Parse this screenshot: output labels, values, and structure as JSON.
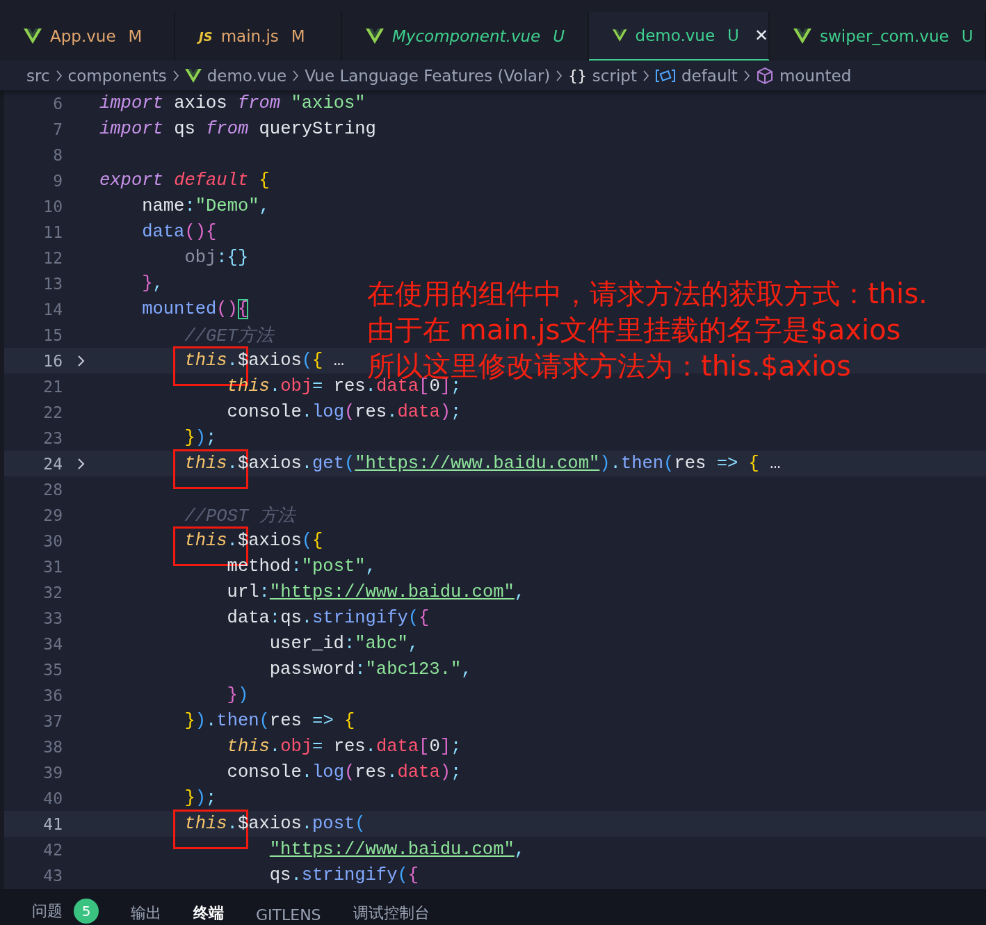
{
  "tabs": [
    {
      "kind": "vue",
      "label": "App.vue",
      "status": "M",
      "color": "#e2a56e",
      "preview": false,
      "selected": false,
      "closable": false
    },
    {
      "kind": "js",
      "label": "main.js",
      "status": "M",
      "color": "#e2a56e",
      "preview": false,
      "selected": false,
      "closable": false
    },
    {
      "kind": "vue",
      "label": "Mycomponent.vue",
      "status": "U",
      "color": "#3fcf8e",
      "preview": true,
      "selected": false,
      "closable": false
    },
    {
      "kind": "vue",
      "label": "demo.vue",
      "status": "U",
      "color": "#3fcf8e",
      "preview": false,
      "selected": true,
      "closable": true
    },
    {
      "kind": "vue",
      "label": "swiper_com.vue",
      "status": "U",
      "color": "#3fcf8e",
      "preview": false,
      "selected": false,
      "closable": false
    }
  ],
  "js_icon_text": "JS",
  "close_glyph": "✕",
  "breadcrumb": [
    {
      "text": "src",
      "kind": "folder"
    },
    {
      "text": "components",
      "kind": "folder"
    },
    {
      "text": "demo.vue",
      "kind": "vue"
    },
    {
      "text": "Vue Language Features (Volar)",
      "kind": "folder"
    },
    {
      "text": "script",
      "kind": "braces",
      "icon_text": "{}"
    },
    {
      "text": "default",
      "kind": "module"
    },
    {
      "text": "mounted",
      "kind": "method"
    }
  ],
  "editor": {
    "lines": [
      {
        "number": "6",
        "folded": false,
        "current": false,
        "tokens": [
          {
            "text": "import",
            "kind": "kw"
          },
          {
            "text": " axios ",
            "kind": "plain"
          },
          {
            "text": "from",
            "kind": "kw"
          },
          {
            "text": " \"axios\"",
            "kind": "str"
          }
        ]
      },
      {
        "number": "7",
        "folded": false,
        "current": false,
        "tokens": [
          {
            "text": "import",
            "kind": "kw"
          },
          {
            "text": " qs ",
            "kind": "plain"
          },
          {
            "text": "from",
            "kind": "kw"
          },
          {
            "text": " queryString",
            "kind": "plain"
          }
        ]
      },
      {
        "number": "8",
        "folded": false,
        "current": false
      },
      {
        "number": "9",
        "folded": false,
        "current": false,
        "tokens": [
          {
            "text": "export",
            "kind": "kw"
          },
          {
            "text": " default",
            "kind": "def"
          },
          {
            "text": " {",
            "kind": "brace"
          }
        ],
        "children": [
          {
            "number": "10",
            "folded": false,
            "current": false,
            "tokens": [
              {
                "text": "name",
                "kind": "plain"
              },
              {
                "text": ":",
                "kind": "punct"
              },
              {
                "text": "\"Demo\"",
                "kind": "str"
              },
              {
                "text": ",",
                "kind": "punct"
              }
            ]
          },
          {
            "number": "11",
            "folded": false,
            "current": false,
            "tokens": [
              {
                "text": "data",
                "kind": "fn"
              },
              {
                "text": "(){",
                "kind": "paren"
              }
            ],
            "children": [
              {
                "number": "12",
                "folded": false,
                "current": false,
                "tokens": [
                  {
                    "text": "obj",
                    "kind": "dim"
                  },
                  {
                    "text": ":{}",
                    "kind": "punct"
                  }
                ]
              }
            ]
          },
          {
            "number": "13",
            "folded": false,
            "current": false,
            "tokens": [
              {
                "text": "}",
                "kind": "paren"
              },
              {
                "text": ",",
                "kind": "punct"
              }
            ]
          },
          {
            "number": "14",
            "folded": false,
            "current": false,
            "tokens": [
              {
                "text": "mounted",
                "kind": "fn"
              },
              {
                "text": "()",
                "kind": "paren"
              },
              {
                "text": "{",
                "kind": "match"
              }
            ],
            "children": [
              {
                "number": "15",
                "folded": false,
                "current": false,
                "tokens": [
                  {
                    "text": "//GET方法",
                    "kind": "comment"
                  }
                ]
              },
              {
                "number": "16",
                "folded": true,
                "current": true,
                "tokens": [
                  {
                    "text": "this",
                    "kind": "this",
                    "boxed": true
                  },
                  {
                    "text": ".",
                    "kind": "punct"
                  },
                  {
                    "text": "$axios",
                    "kind": "plain"
                  },
                  {
                    "text": "(",
                    "kind": "paren2"
                  },
                  {
                    "text": "{",
                    "kind": "brace"
                  },
                  {
                    "text": " …",
                    "kind": "plain"
                  }
                ],
                "children": [
                  {
                    "number": "21",
                    "folded": false,
                    "current": false,
                    "tokens": [
                      {
                        "text": "this",
                        "kind": "this"
                      },
                      {
                        "text": ".",
                        "kind": "punct"
                      },
                      {
                        "text": "obj",
                        "kind": "red"
                      },
                      {
                        "text": "=",
                        "kind": "punct"
                      },
                      {
                        "text": " res",
                        "kind": "plain"
                      },
                      {
                        "text": ".",
                        "kind": "punct"
                      },
                      {
                        "text": "data",
                        "kind": "red"
                      },
                      {
                        "text": "[",
                        "kind": "paren"
                      },
                      {
                        "text": "0",
                        "kind": "plain"
                      },
                      {
                        "text": "]",
                        "kind": "paren"
                      },
                      {
                        "text": ";",
                        "kind": "punct"
                      }
                    ]
                  },
                  {
                    "number": "22",
                    "folded": false,
                    "current": false,
                    "tokens": [
                      {
                        "text": "console",
                        "kind": "plain"
                      },
                      {
                        "text": ".",
                        "kind": "punct"
                      },
                      {
                        "text": "log",
                        "kind": "fn"
                      },
                      {
                        "text": "(",
                        "kind": "paren"
                      },
                      {
                        "text": "res",
                        "kind": "plain"
                      },
                      {
                        "text": ".",
                        "kind": "punct"
                      },
                      {
                        "text": "data",
                        "kind": "red"
                      },
                      {
                        "text": ")",
                        "kind": "paren"
                      },
                      {
                        "text": ";",
                        "kind": "punct"
                      }
                    ]
                  }
                ]
              },
              {
                "number": "23",
                "folded": false,
                "current": false,
                "tokens": [
                  {
                    "text": "}",
                    "kind": "brace"
                  },
                  {
                    "text": ")",
                    "kind": "paren2"
                  },
                  {
                    "text": ";",
                    "kind": "punct"
                  }
                ]
              },
              {
                "number": "24",
                "folded": true,
                "current": true,
                "tokens": [
                  {
                    "text": "this",
                    "kind": "this",
                    "boxed": true
                  },
                  {
                    "text": ".",
                    "kind": "punct"
                  },
                  {
                    "text": "$axios",
                    "kind": "plain"
                  },
                  {
                    "text": ".",
                    "kind": "punct"
                  },
                  {
                    "text": "get",
                    "kind": "fn"
                  },
                  {
                    "text": "(",
                    "kind": "paren2"
                  },
                  {
                    "text": "\"https://www.baidu.com\"",
                    "kind": "link"
                  },
                  {
                    "text": ")",
                    "kind": "paren2"
                  },
                  {
                    "text": ".",
                    "kind": "punct"
                  },
                  {
                    "text": "then",
                    "kind": "fn"
                  },
                  {
                    "text": "(",
                    "kind": "paren2"
                  },
                  {
                    "text": "res ",
                    "kind": "plain"
                  },
                  {
                    "text": "=>",
                    "kind": "punct"
                  },
                  {
                    "text": " {",
                    "kind": "brace"
                  },
                  {
                    "text": " …",
                    "kind": "plain"
                  }
                ]
              },
              {
                "number": "28",
                "folded": false,
                "current": false
              },
              {
                "number": "29",
                "folded": false,
                "current": false,
                "tokens": [
                  {
                    "text": "//POST 方法",
                    "kind": "comment"
                  }
                ]
              },
              {
                "number": "30",
                "folded": false,
                "current": false,
                "tokens": [
                  {
                    "text": "this",
                    "kind": "this",
                    "boxed": true
                  },
                  {
                    "text": ".",
                    "kind": "punct"
                  },
                  {
                    "text": "$axios",
                    "kind": "plain"
                  },
                  {
                    "text": "(",
                    "kind": "paren2"
                  },
                  {
                    "text": "{",
                    "kind": "brace"
                  }
                ],
                "children": [
                  {
                    "number": "31",
                    "folded": false,
                    "current": false,
                    "tokens": [
                      {
                        "text": "method",
                        "kind": "plain"
                      },
                      {
                        "text": ":",
                        "kind": "punct"
                      },
                      {
                        "text": "\"post\"",
                        "kind": "str"
                      },
                      {
                        "text": ",",
                        "kind": "punct"
                      }
                    ]
                  },
                  {
                    "number": "32",
                    "folded": false,
                    "current": false,
                    "tokens": [
                      {
                        "text": "url",
                        "kind": "plain"
                      },
                      {
                        "text": ":",
                        "kind": "punct"
                      },
                      {
                        "text": "\"https://www.baidu.com\"",
                        "kind": "link"
                      },
                      {
                        "text": ",",
                        "kind": "punct"
                      }
                    ]
                  },
                  {
                    "number": "33",
                    "folded": false,
                    "current": false,
                    "tokens": [
                      {
                        "text": "data",
                        "kind": "plain"
                      },
                      {
                        "text": ":",
                        "kind": "punct"
                      },
                      {
                        "text": "qs",
                        "kind": "plain"
                      },
                      {
                        "text": ".",
                        "kind": "punct"
                      },
                      {
                        "text": "stringify",
                        "kind": "fn"
                      },
                      {
                        "text": "(",
                        "kind": "paren2"
                      },
                      {
                        "text": "{",
                        "kind": "paren"
                      }
                    ],
                    "children": [
                      {
                        "number": "34",
                        "folded": false,
                        "current": false,
                        "tokens": [
                          {
                            "text": "user_id",
                            "kind": "plain"
                          },
                          {
                            "text": ":",
                            "kind": "punct"
                          },
                          {
                            "text": "\"abc\"",
                            "kind": "str"
                          },
                          {
                            "text": ",",
                            "kind": "punct"
                          }
                        ]
                      },
                      {
                        "number": "35",
                        "folded": false,
                        "current": false,
                        "tokens": [
                          {
                            "text": "password",
                            "kind": "plain"
                          },
                          {
                            "text": ":",
                            "kind": "punct"
                          },
                          {
                            "text": "\"abc123.\"",
                            "kind": "str"
                          },
                          {
                            "text": ",",
                            "kind": "punct"
                          }
                        ]
                      }
                    ]
                  },
                  {
                    "number": "36",
                    "folded": false,
                    "current": false,
                    "tokens": [
                      {
                        "text": "}",
                        "kind": "paren"
                      },
                      {
                        "text": ")",
                        "kind": "paren2"
                      }
                    ]
                  }
                ]
              },
              {
                "number": "37",
                "folded": false,
                "current": false,
                "tokens": [
                  {
                    "text": "}",
                    "kind": "brace"
                  },
                  {
                    "text": ")",
                    "kind": "paren2"
                  },
                  {
                    "text": ".",
                    "kind": "punct"
                  },
                  {
                    "text": "then",
                    "kind": "fn"
                  },
                  {
                    "text": "(",
                    "kind": "paren2"
                  },
                  {
                    "text": "res ",
                    "kind": "plain"
                  },
                  {
                    "text": "=>",
                    "kind": "punct"
                  },
                  {
                    "text": " {",
                    "kind": "brace"
                  }
                ],
                "children": [
                  {
                    "number": "38",
                    "folded": false,
                    "current": false,
                    "tokens": [
                      {
                        "text": "this",
                        "kind": "this"
                      },
                      {
                        "text": ".",
                        "kind": "punct"
                      },
                      {
                        "text": "obj",
                        "kind": "red"
                      },
                      {
                        "text": "=",
                        "kind": "punct"
                      },
                      {
                        "text": " res",
                        "kind": "plain"
                      },
                      {
                        "text": ".",
                        "kind": "punct"
                      },
                      {
                        "text": "data",
                        "kind": "red"
                      },
                      {
                        "text": "[",
                        "kind": "paren"
                      },
                      {
                        "text": "0",
                        "kind": "plain"
                      },
                      {
                        "text": "]",
                        "kind": "paren"
                      },
                      {
                        "text": ";",
                        "kind": "punct"
                      }
                    ]
                  },
                  {
                    "number": "39",
                    "folded": false,
                    "current": false,
                    "tokens": [
                      {
                        "text": "console",
                        "kind": "plain"
                      },
                      {
                        "text": ".",
                        "kind": "punct"
                      },
                      {
                        "text": "log",
                        "kind": "fn"
                      },
                      {
                        "text": "(",
                        "kind": "paren"
                      },
                      {
                        "text": "res",
                        "kind": "plain"
                      },
                      {
                        "text": ".",
                        "kind": "punct"
                      },
                      {
                        "text": "data",
                        "kind": "red"
                      },
                      {
                        "text": ")",
                        "kind": "paren"
                      },
                      {
                        "text": ";",
                        "kind": "punct"
                      }
                    ]
                  }
                ]
              },
              {
                "number": "40",
                "folded": false,
                "current": false,
                "tokens": [
                  {
                    "text": "}",
                    "kind": "brace"
                  },
                  {
                    "text": ")",
                    "kind": "paren2"
                  },
                  {
                    "text": ";",
                    "kind": "punct"
                  }
                ]
              },
              {
                "number": "41",
                "folded": false,
                "current": true,
                "tokens": [
                  {
                    "text": "this",
                    "kind": "this",
                    "boxed": true
                  },
                  {
                    "text": ".",
                    "kind": "punct"
                  },
                  {
                    "text": "$axios",
                    "kind": "plain"
                  },
                  {
                    "text": ".",
                    "kind": "punct"
                  },
                  {
                    "text": "post",
                    "kind": "fn"
                  },
                  {
                    "text": "(",
                    "kind": "paren2"
                  }
                ],
                "children": [
                  {
                    "number": "42",
                    "folded": false,
                    "current": false,
                    "continuation": true,
                    "tokens": [
                      {
                        "text": "\"https://www.baidu.com\"",
                        "kind": "link"
                      },
                      {
                        "text": ",",
                        "kind": "punct"
                      }
                    ]
                  },
                  {
                    "number": "43",
                    "folded": false,
                    "current": false,
                    "continuation": true,
                    "tokens": [
                      {
                        "text": "qs",
                        "kind": "plain"
                      },
                      {
                        "text": ".",
                        "kind": "punct"
                      },
                      {
                        "text": "stringify",
                        "kind": "fn"
                      },
                      {
                        "text": "(",
                        "kind": "paren2"
                      },
                      {
                        "text": "{",
                        "kind": "paren"
                      }
                    ]
                  }
                ]
              }
            ]
          }
        ]
      }
    ]
  },
  "annotation": [
    "在使用的组件中，请求方法的获取方式：this.",
    "由于在 main.js文件里挂载的名字是$axios",
    "所以这里修改请求方法为：this.$axios"
  ],
  "panel_tabs": [
    {
      "label": "问题",
      "badge": "5",
      "selected": false
    },
    {
      "label": "输出",
      "selected": false
    },
    {
      "label": "终端",
      "selected": true
    },
    {
      "label": "GITLENS",
      "selected": false
    },
    {
      "label": "调试控制台",
      "selected": false
    }
  ]
}
